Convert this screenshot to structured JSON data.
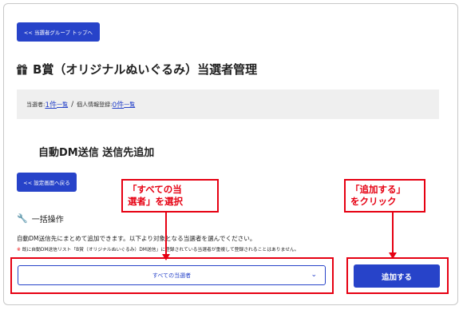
{
  "nav": {
    "back_to_group": "<< 当選者グループ トップへ"
  },
  "page": {
    "title": "B賞（オリジナルぬいぐるみ）当選者管理"
  },
  "status": {
    "winners_label": "当選者: ",
    "winners_count": "1件",
    "winners_list": "一覧",
    "sep": "/",
    "registered_label": "個人情報登録: ",
    "registered_count": "0件",
    "registered_list": "一覧"
  },
  "section": {
    "title": "自動DM送信 送信先追加"
  },
  "settings": {
    "back_label": "<< 設定画面へ戻る"
  },
  "bulk": {
    "label": "一括操作",
    "description": "自動DM送信先にまとめて追加できます。以下より対象となる当選者を選んでください。",
    "note_mark": "※",
    "note": "既に自動DM送信リスト「B賞（オリジナルぬいぐるみ）DM送信」に登録されている当選者が重複して登録されることはありません。",
    "select_value": "すべての当選者",
    "add_button": "追加する"
  },
  "annotations": {
    "select_line1": "「すべての当",
    "select_line2": "選者」を選択",
    "add_line1": "「追加する」",
    "add_line2": "をクリック"
  },
  "colors": {
    "primary": "#2743c9",
    "annotation_red": "#e60012"
  }
}
